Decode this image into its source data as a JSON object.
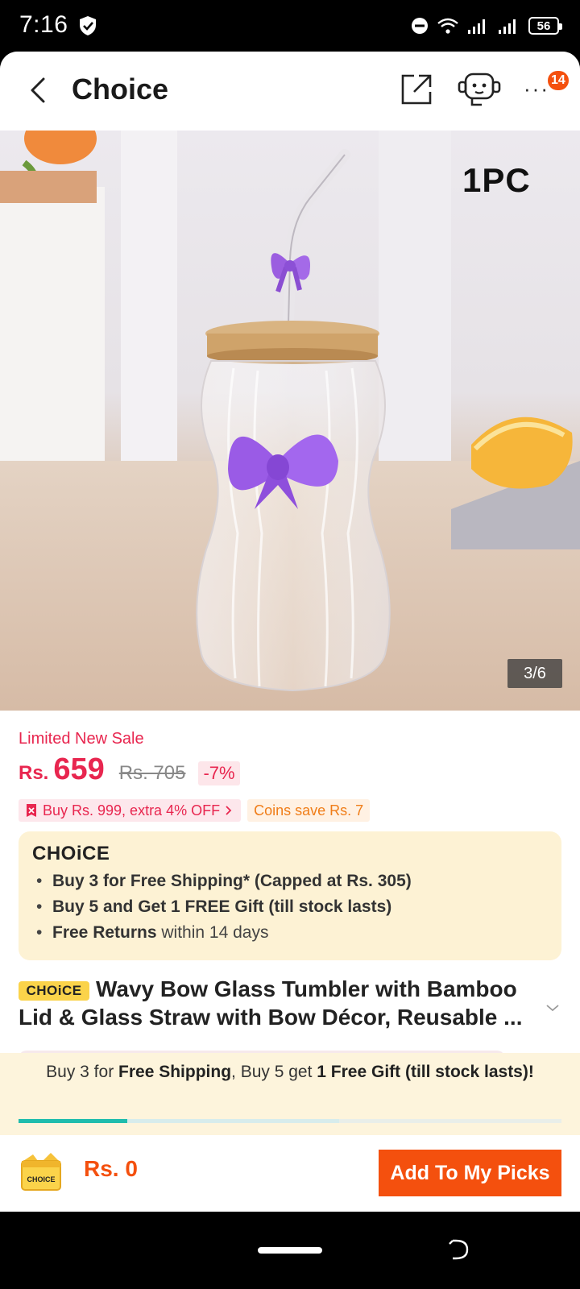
{
  "status_bar": {
    "time": "7:16",
    "battery": "56",
    "icons": [
      "shield-icon",
      "dnd-icon",
      "wifi-icon",
      "signal-icon",
      "signal-icon",
      "battery-icon"
    ]
  },
  "header": {
    "title": "Choice",
    "notification_count": "14",
    "icons": [
      "back-arrow-icon",
      "share-icon",
      "support-bot-icon",
      "more-icon"
    ]
  },
  "product_image": {
    "overlay_text": "1PC",
    "counter": "3/6"
  },
  "pricing": {
    "sale_label": "Limited New Sale",
    "currency": "Rs.",
    "price": "659",
    "original_price": "Rs. 705",
    "discount": "-7%"
  },
  "promos": {
    "threshold": "Buy Rs. 999, extra 4% OFF",
    "coins": "Coins save Rs. 7"
  },
  "choice_box": {
    "logo": "CHOiCE",
    "benefits": [
      {
        "bold": "Buy 3 for  Free Shipping* (Capped at Rs. 305)",
        "rest": ""
      },
      {
        "bold": "Buy 5 and Get 1 FREE Gift (till stock lasts)",
        "rest": ""
      },
      {
        "bold": "Free Returns",
        "rest": " within 14 days"
      }
    ]
  },
  "product": {
    "badge": "CHOiCE",
    "title": "Wavy Bow Glass Tumbler with Bamboo Lid & Glass Straw with Bow Décor, Reusable ..."
  },
  "shipping_banner": {
    "part1": "Buy 3 for ",
    "part2": "Free Shipping",
    "part3": ", Buy 5 get ",
    "part4": "1 Free Gift (till stock lasts)!",
    "progress": 0.2
  },
  "bottom_bar": {
    "cart_label": "CHOICE",
    "total": "Rs. 0",
    "add_button": "Add To My Picks"
  },
  "colors": {
    "accent": "#f4500e",
    "sale_red": "#e8264f",
    "choice_yellow": "#fbd34a",
    "progress_teal": "#1fbcad"
  }
}
